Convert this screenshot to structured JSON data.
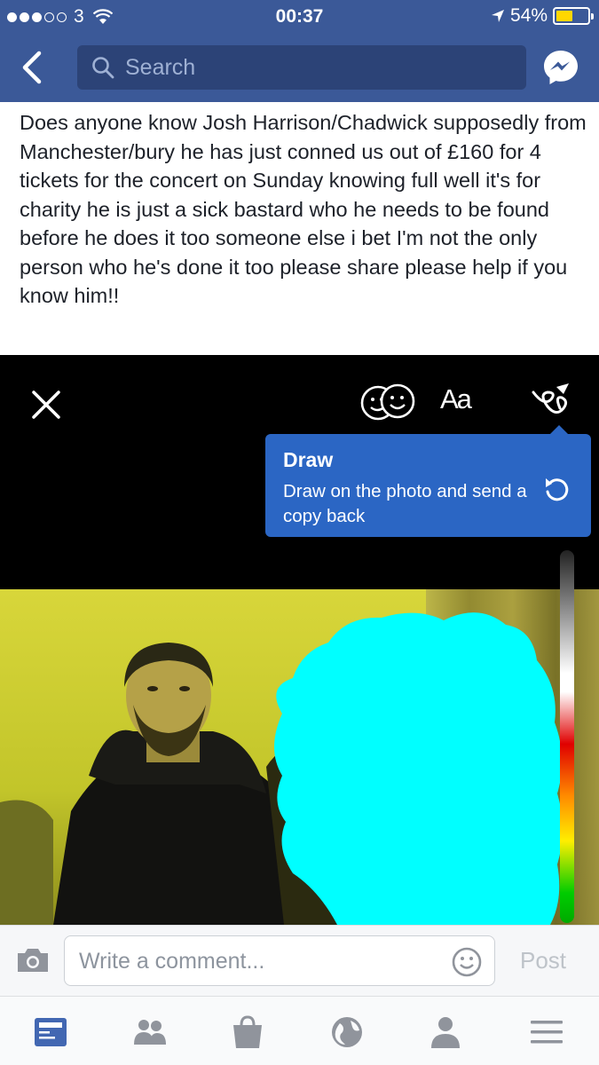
{
  "status": {
    "carrier": "3",
    "time": "00:37",
    "battery": "54%",
    "battery_fill": 0.54
  },
  "nav": {
    "search_placeholder": "Search"
  },
  "post": {
    "text": "Does anyone know Josh Harrison/Chadwick supposedly from Manchester/bury he has just conned us out of £160 for 4 tickets for the concert on Sunday knowing full well it's for charity he is just a sick bastard who he needs to be found before he does it too someone else i bet I'm not the only person who he's done it too please share please help if you know him!!"
  },
  "editor": {
    "text_tool": "Aa",
    "tooltip": {
      "title": "Draw",
      "body": "Draw on the photo and send a copy back"
    },
    "accent": "#2b66c4",
    "highlight_color": "#00ffff"
  },
  "comment": {
    "placeholder": "Write a comment...",
    "post_label": "Post"
  },
  "tabs": [
    "news-feed",
    "friends",
    "marketplace",
    "notifications",
    "profile",
    "menu"
  ],
  "colors": {
    "header": "#3b5998",
    "search_bg": "#2c4377"
  }
}
